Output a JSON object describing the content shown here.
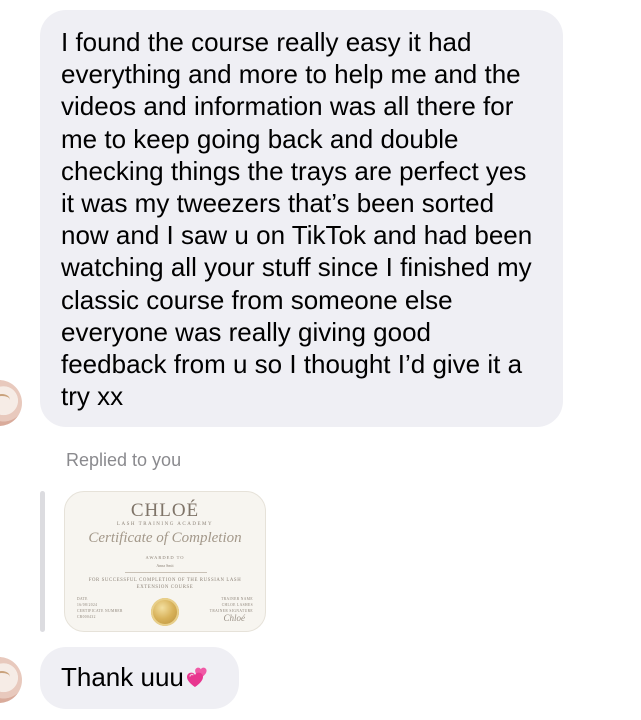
{
  "message_1": {
    "lines": [
      "I found the course really easy it had",
      "everything and more to help me and the",
      "videos and information was all there for",
      "me to keep going back and double",
      "checking things the trays are perfect yes",
      "it was my tweezers that’s been sorted",
      "now and I saw u on TikTok and had been",
      "watching all your stuff since I finished my",
      "classic course from someone else",
      "everyone was really giving good",
      "feedback from u so I thought I’d give it a",
      "try xx"
    ]
  },
  "reply": {
    "label": "Replied to you",
    "certificate": {
      "brand": "CHLOÉ",
      "subtitle": "LASH TRAINING ACADEMY",
      "title": "Certificate of Completion",
      "awarded": "AWARDED TO",
      "recipient": "Anna Smit",
      "body_1": "FOR SUCCESSFUL COMPLETION OF THE RUSSIAN LASH",
      "body_2": "EXTENSION COURSE",
      "left_block": "DATE\n16/08/2024\nCERTIFICATE NUMBER\nCR000432",
      "right_block": "TRAINER NAME\nCHLOE LASHES\nTRAINER SIGNATURE",
      "signature": "Chloé"
    }
  },
  "message_2": {
    "text": "Thank uuu",
    "emoji": "revolving-hearts-icon"
  },
  "colors": {
    "bubble": "#efeff4",
    "muted_text": "#8a8a8e",
    "heart_pink": "#e8368f"
  }
}
